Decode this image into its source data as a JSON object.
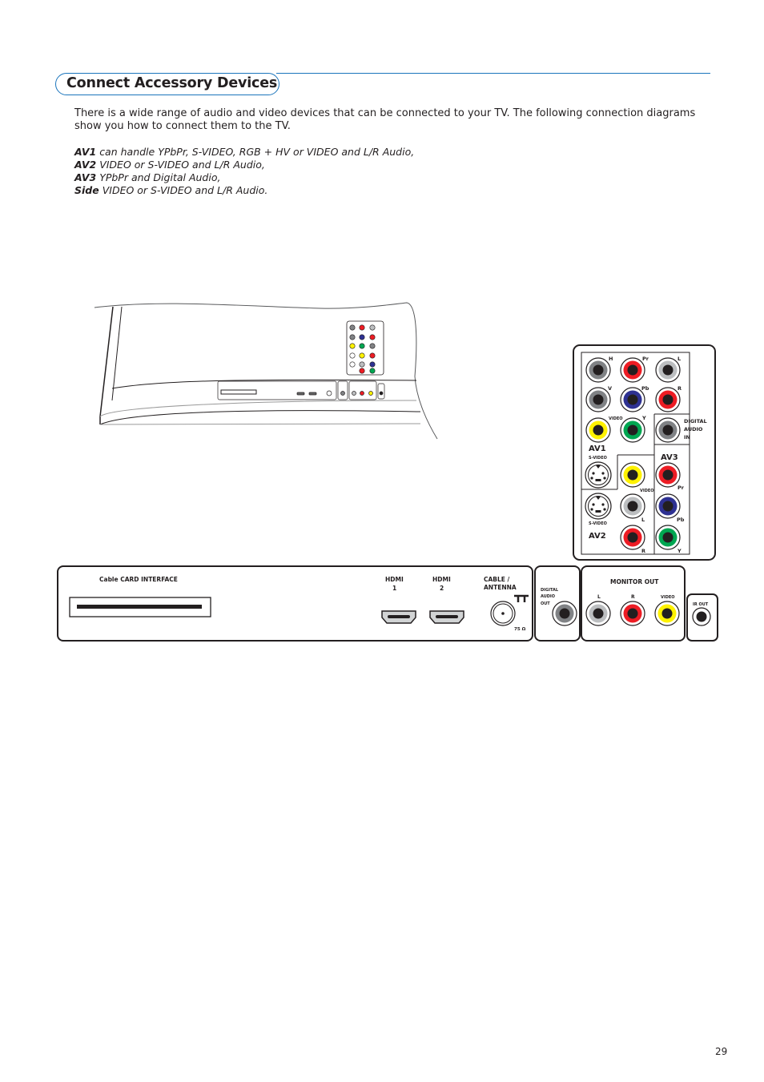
{
  "header": {
    "title": "Connect Accessory Devices",
    "accent_color": "#1b75bc"
  },
  "intro": "There is a wide range of audio and video devices that can be connected to your TV. The following connection diagrams show you how to connect them to the TV.",
  "av_descriptions": [
    {
      "name": "AV1",
      "text": "can handle YPbPr, S-VIDEO, RGB + HV or VIDEO and L/R Audio,"
    },
    {
      "name": "AV2",
      "text": "VIDEO or S-VIDEO and L/R Audio,"
    },
    {
      "name": "AV3",
      "text": "YPbPr and Digital Audio,"
    },
    {
      "name": "Side",
      "text": "VIDEO or S-VIDEO and L/R Audio."
    }
  ],
  "side_panel": {
    "labels": {
      "H": "H",
      "Pr": "Pr",
      "L": "L",
      "V": "V",
      "Pb": "Pb",
      "R": "R",
      "video": "VIDEO",
      "Y": "Y",
      "digital_audio_in": [
        "DIGITAL",
        "AUDIO",
        "IN"
      ],
      "av1": "AV1",
      "av2": "AV2",
      "av3": "AV3",
      "svideo": "S-VIDEO"
    }
  },
  "bottom_panel": {
    "cable_card": "Cable CARD INTERFACE",
    "hdmi1": [
      "HDMI",
      "1"
    ],
    "hdmi2": [
      "HDMI",
      "2"
    ],
    "cable_antenna": [
      "CABLE /",
      "ANTENNA"
    ],
    "ohms": "75 Ω",
    "digital_audio_out": [
      "DIGITAL",
      "AUDIO",
      "OUT"
    ],
    "monitor_out": "MONITOR OUT",
    "monitor_labels": [
      "L",
      "R",
      "VIDEO"
    ],
    "ir_out": "IR OUT"
  },
  "colors": {
    "red": "#ed1c24",
    "blue": "#2e3192",
    "green": "#00a651",
    "yellow": "#fff200",
    "dark_gray": "#808285",
    "light_gray": "#bcbec0"
  },
  "page_number": "29"
}
